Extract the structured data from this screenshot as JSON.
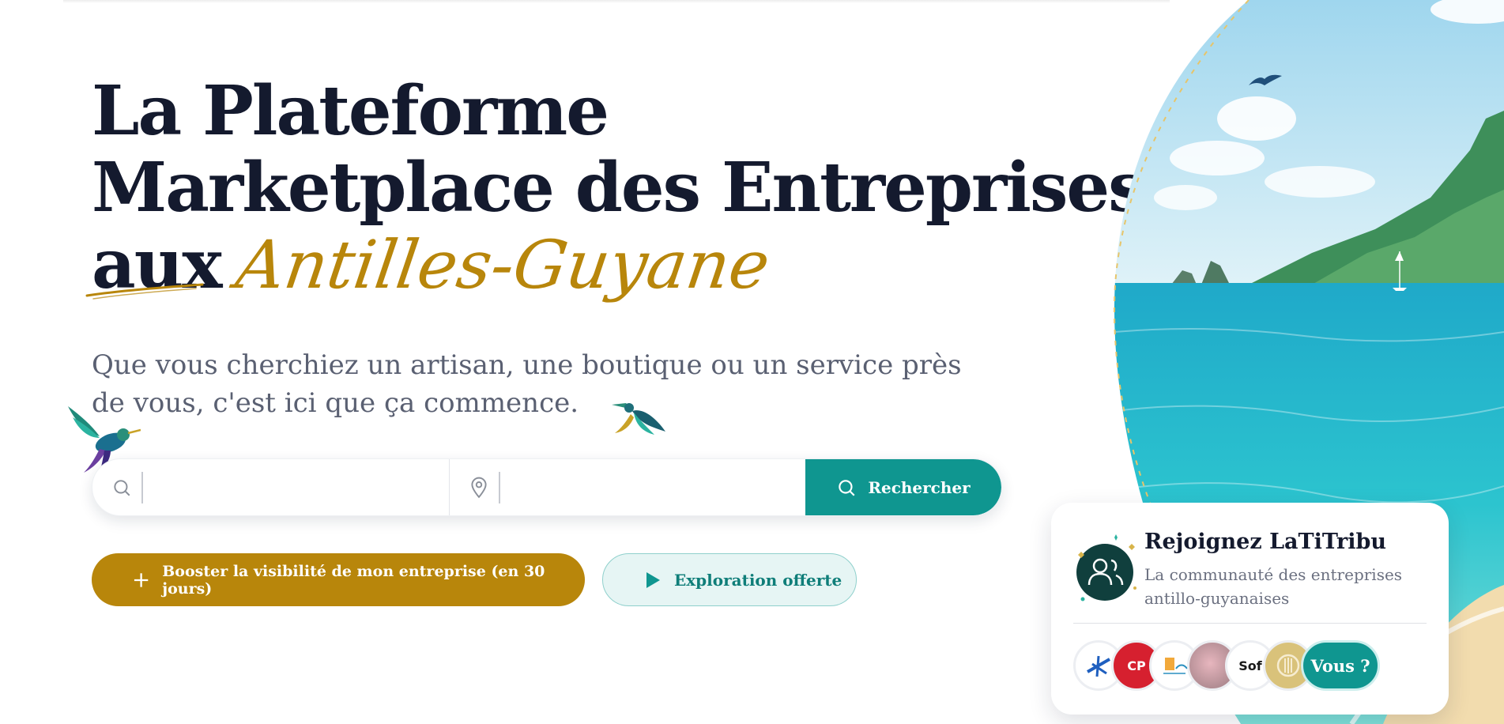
{
  "hero": {
    "title_line1": "La Plateforme",
    "title_line2": "Marketplace des Entreprises",
    "title_aux": "aux",
    "title_script": "Antilles-Guyane",
    "subtitle": "Que vous cherchiez un artisan, une boutique ou un service près de vous, c'est ici que ça commence."
  },
  "search": {
    "what_icon": "search-icon",
    "where_icon": "map-pin-icon",
    "what_value": "",
    "where_value": "",
    "button_label": "Rechercher"
  },
  "cta": {
    "boost_label": "Booster la visibilité de mon entreprise (en 30 jours)",
    "explore_label": "Exploration offerte"
  },
  "join_card": {
    "title": "Rejoignez LaTiTribu",
    "subtitle": "La communauté des entreprises antillo-guyanaises",
    "cta_label": "Vous ?",
    "avatars": [
      {
        "name": "logo-blue-figure",
        "text": ""
      },
      {
        "name": "logo-cp-protect",
        "text": "CP"
      },
      {
        "name": "logo-antilles",
        "text": ""
      },
      {
        "name": "logo-pink-photo",
        "text": ""
      },
      {
        "name": "logo-sof",
        "text": "Sof"
      },
      {
        "name": "logo-gold-circle",
        "text": ""
      }
    ]
  },
  "colors": {
    "primary_teal": "#0f9690",
    "gold": "#b8860b",
    "heading": "#141a2e",
    "text_muted": "#5a6072"
  }
}
